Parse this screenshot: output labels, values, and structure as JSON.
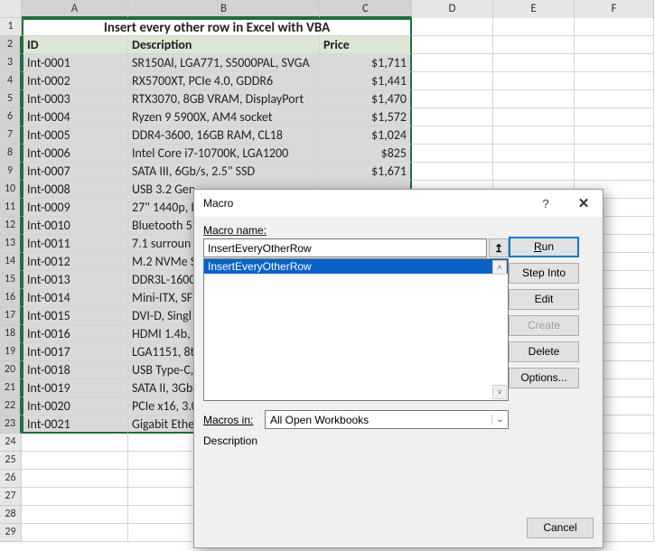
{
  "title": "Insert every other row in Excel with VBA",
  "columns": [
    "A",
    "B",
    "C",
    "D",
    "E",
    "F"
  ],
  "headers": {
    "id": "ID",
    "desc": "Description",
    "price": "Price"
  },
  "rows": [
    {
      "n": 3,
      "id": "Int-0001",
      "desc": "SR150Al, LGA771, S5000PAL, SVGA",
      "price": "$1,711"
    },
    {
      "n": 4,
      "id": "Int-0002",
      "desc": "RX5700XT, PCIe 4.0, GDDR6",
      "price": "$1,441"
    },
    {
      "n": 5,
      "id": "Int-0003",
      "desc": "RTX3070, 8GB VRAM, DisplayPort",
      "price": "$1,470"
    },
    {
      "n": 6,
      "id": "Int-0004",
      "desc": "Ryzen 9 5900X, AM4 socket",
      "price": "$1,572"
    },
    {
      "n": 7,
      "id": "Int-0005",
      "desc": "DDR4-3600, 16GB RAM, CL18",
      "price": "$1,024"
    },
    {
      "n": 8,
      "id": "Int-0006",
      "desc": "Intel Core i7-10700K, LGA1200",
      "price": "$825"
    },
    {
      "n": 9,
      "id": "Int-0007",
      "desc": "SATA III, 6Gb/s, 2.5\" SSD",
      "price": "$1,671"
    },
    {
      "n": 10,
      "id": "Int-0008",
      "desc": "USB 3.2 Gen",
      "price": ""
    },
    {
      "n": 11,
      "id": "Int-0009",
      "desc": "27\" 1440p, I",
      "price": ""
    },
    {
      "n": 12,
      "id": "Int-0010",
      "desc": "Bluetooth 5",
      "price": ""
    },
    {
      "n": 13,
      "id": "Int-0011",
      "desc": "7.1 surroun",
      "price": ""
    },
    {
      "n": 14,
      "id": "Int-0012",
      "desc": "M.2 NVMe S",
      "price": ""
    },
    {
      "n": 15,
      "id": "Int-0013",
      "desc": "DDR3L-1600",
      "price": ""
    },
    {
      "n": 16,
      "id": "Int-0014",
      "desc": "Mini-ITX, SF",
      "price": ""
    },
    {
      "n": 17,
      "id": "Int-0015",
      "desc": "DVI-D, Singl",
      "price": ""
    },
    {
      "n": 18,
      "id": "Int-0016",
      "desc": "HDMI 1.4b, 4",
      "price": ""
    },
    {
      "n": 19,
      "id": "Int-0017",
      "desc": "LGA1151, 8t",
      "price": ""
    },
    {
      "n": 20,
      "id": "Int-0018",
      "desc": "USB Type-C,",
      "price": ""
    },
    {
      "n": 21,
      "id": "Int-0019",
      "desc": "SATA II, 3Gb",
      "price": ""
    },
    {
      "n": 22,
      "id": "Int-0020",
      "desc": "PCIe x16, 3.0",
      "price": ""
    },
    {
      "n": 23,
      "id": "Int-0021",
      "desc": "Gigabit Ethe",
      "price": ""
    }
  ],
  "empty_rows": [
    24,
    25,
    26,
    27,
    28,
    29
  ],
  "dialog": {
    "title": "Macro",
    "name_label": "Macro name:",
    "name_value": "InsertEveryOtherRow",
    "list_selected": "InsertEveryOtherRow",
    "macros_in_label": "Macros in:",
    "macros_in_value": "All Open Workbooks",
    "description_label": "Description",
    "buttons": {
      "run": "Run",
      "step_into": "Step Into",
      "edit": "Edit",
      "create": "Create",
      "delete": "Delete",
      "options": "Options...",
      "cancel": "Cancel"
    }
  }
}
